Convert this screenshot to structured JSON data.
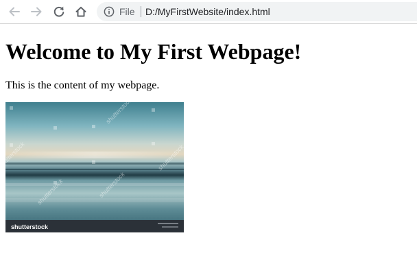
{
  "browser": {
    "address_bar": {
      "scheme_label": "File",
      "url": "D:/MyFirstWebsite/index.html"
    },
    "icons": {
      "back": "arrow-left-icon",
      "forward": "arrow-right-icon",
      "reload": "reload-icon",
      "home": "home-icon",
      "info": "info-icon"
    }
  },
  "page": {
    "heading": "Welcome to My First Webpage!",
    "paragraph": "This is the content of my webpage.",
    "image": {
      "description": "seascape stock photo",
      "watermark_logo": "shutterstock",
      "watermark_repeat": "shutterstock"
    }
  },
  "colors": {
    "toolbar_bg": "#ffffff",
    "omnibox_bg": "#f1f3f4",
    "disabled_icon": "#bdc1c6",
    "active_icon": "#5f6368",
    "page_text": "#000000",
    "photo_sky_top": "#3f7f8e",
    "photo_water": "#3e6f7d",
    "photo_footer": "#2b3138"
  }
}
